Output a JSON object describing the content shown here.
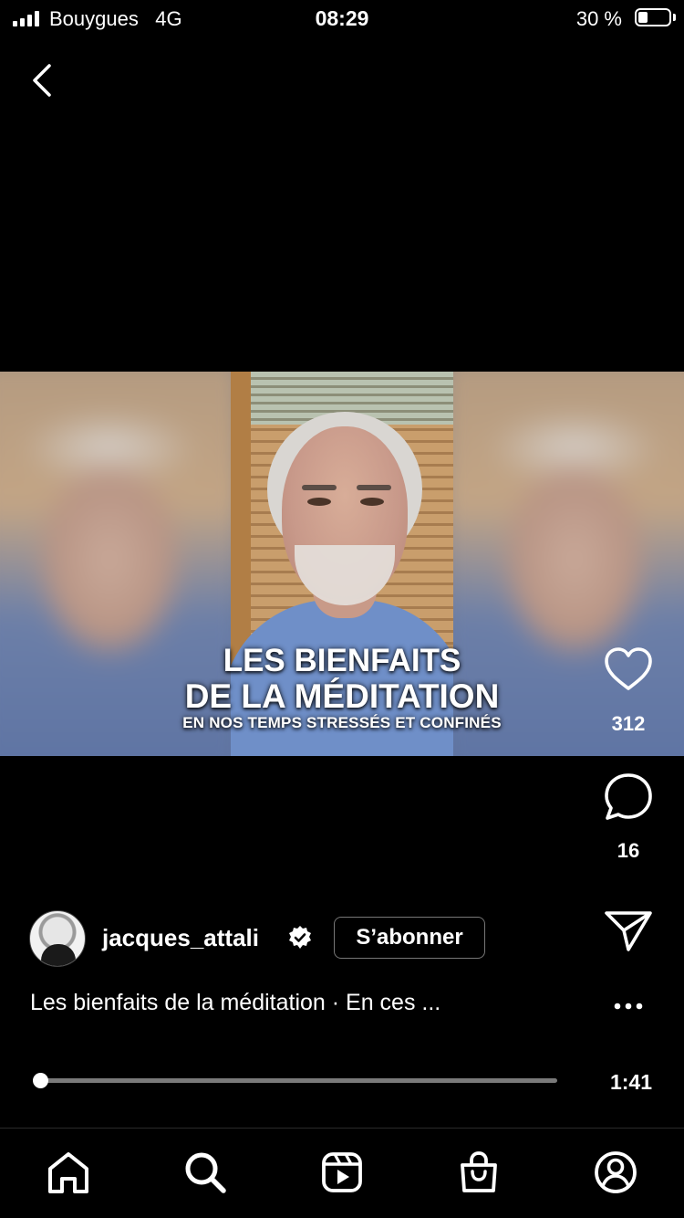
{
  "status_bar": {
    "carrier": "Bouygues",
    "network": "4G",
    "time": "08:29",
    "battery_percent_text": "30 %",
    "battery_level": 0.3
  },
  "nav": {
    "back_icon": "chevron-left-icon"
  },
  "video": {
    "overlay_line1": "LES BIENFAITS",
    "overlay_line2": "DE LA MÉDITATION",
    "overlay_line3": "EN NOS TEMPS STRESSÉS ET CONFINÉS"
  },
  "actions": {
    "likes": "312",
    "comments": "16",
    "like_icon": "heart-icon",
    "comment_icon": "comment-icon",
    "share_icon": "send-icon",
    "more_icon": "more-horizontal-icon"
  },
  "author": {
    "username": "jacques_attali",
    "verified": true,
    "follow_label": "S’abonner"
  },
  "caption": "Les bienfaits de la méditation · En ces ...",
  "player": {
    "duration": "1:41",
    "progress": 0.01
  },
  "tab_bar": [
    "home-icon",
    "search-icon",
    "reels-icon",
    "shop-icon",
    "profile-icon"
  ]
}
